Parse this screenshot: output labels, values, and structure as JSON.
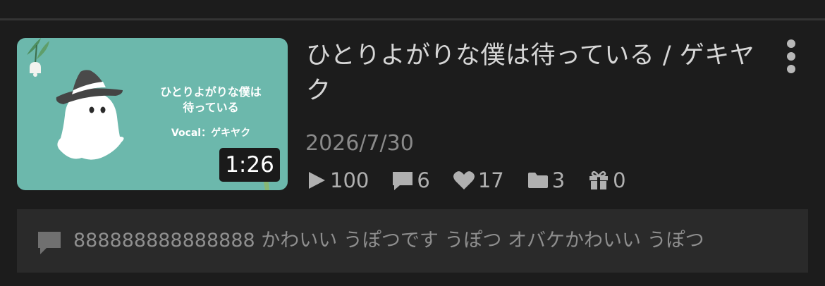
{
  "video": {
    "title": "ひとりよがりな僕は待っている / ゲキヤク",
    "date": "2026/7/30",
    "duration": "1:26",
    "thumbnail": {
      "title": "ひとりよがりな僕は\n待っている",
      "vocal": "Vocal：ゲキヤク",
      "background_color": "#6cb8ac"
    },
    "stats": {
      "plays": "100",
      "comments": "6",
      "likes": "17",
      "mylists": "3",
      "gifts": "0"
    }
  },
  "comment_bar": {
    "text": "888888888888888 かわいい うぽつです うぽつ オバケかわいい うぽつ"
  },
  "icons": {
    "more": "more-vertical-icon",
    "play": "play-icon",
    "comment": "comment-icon",
    "like": "heart-icon",
    "mylist": "folder-icon",
    "gift": "gift-icon"
  }
}
